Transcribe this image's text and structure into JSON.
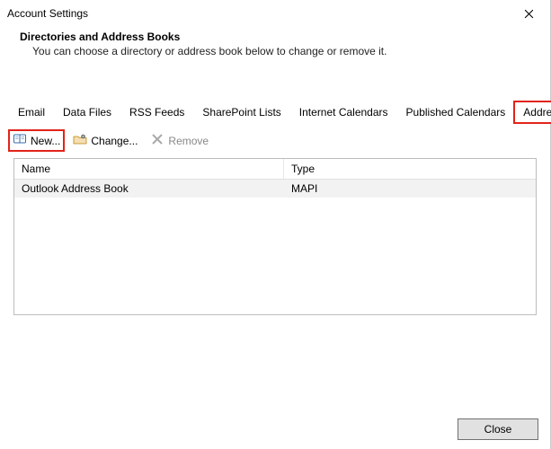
{
  "window": {
    "title": "Account Settings"
  },
  "header": {
    "title": "Directories and Address Books",
    "description": "You can choose a directory or address book below to change or remove it."
  },
  "tabs": [
    {
      "label": "Email"
    },
    {
      "label": "Data Files"
    },
    {
      "label": "RSS Feeds"
    },
    {
      "label": "SharePoint Lists"
    },
    {
      "label": "Internet Calendars"
    },
    {
      "label": "Published Calendars"
    },
    {
      "label": "Address Books",
      "active": true,
      "highlight": true
    }
  ],
  "toolbar": {
    "new_label": "New...",
    "change_label": "Change...",
    "remove_label": "Remove"
  },
  "table": {
    "columns": {
      "name": "Name",
      "type": "Type"
    },
    "rows": [
      {
        "name": "Outlook Address Book",
        "type": "MAPI"
      }
    ]
  },
  "footer": {
    "close_label": "Close"
  }
}
